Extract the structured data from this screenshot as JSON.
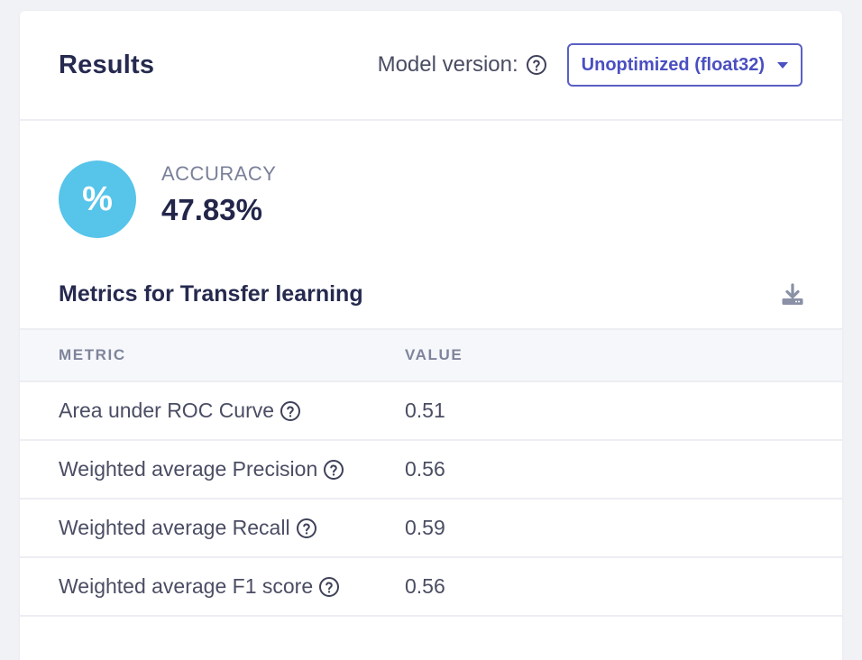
{
  "header": {
    "title": "Results",
    "model_version_label": "Model version:",
    "model_version_value": "Unoptimized (float32)"
  },
  "accuracy": {
    "icon_symbol": "%",
    "label": "ACCURACY",
    "value": "47.83%",
    "icon_color": "#57c4ea"
  },
  "metrics": {
    "title": "Metrics for Transfer learning",
    "columns": [
      "METRIC",
      "VALUE"
    ],
    "rows": [
      {
        "metric": "Area under ROC Curve",
        "value": "0.51"
      },
      {
        "metric": "Weighted average Precision",
        "value": "0.56"
      },
      {
        "metric": "Weighted average Recall",
        "value": "0.59"
      },
      {
        "metric": "Weighted average F1 score",
        "value": "0.56"
      }
    ]
  },
  "icons": {
    "help": "question-circle-icon",
    "download": "download-icon",
    "dropdown": "chevron-down-icon"
  },
  "colors": {
    "accent": "#4a4fc1",
    "text_primary": "#23264a",
    "text_secondary": "#4a4d63"
  }
}
